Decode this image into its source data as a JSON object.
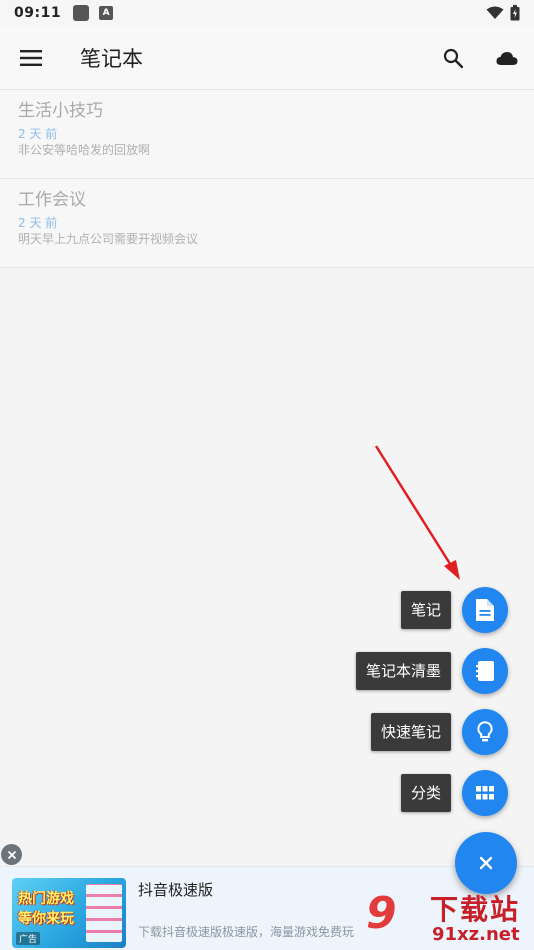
{
  "status_bar": {
    "time": "09:11",
    "a_badge": "A"
  },
  "app_bar": {
    "title": "笔记本",
    "menu_icon": "menu-icon",
    "search_icon": "search-icon",
    "cloud_icon": "cloud-icon"
  },
  "notes": [
    {
      "title": "生活小技巧",
      "date": "2 天 前",
      "preview": "非公安等哈哈发的回放啊"
    },
    {
      "title": "工作会议",
      "date": "2 天 前",
      "preview": "明天早上九点公司需要开视频会议"
    }
  ],
  "fab_menu": {
    "items": [
      {
        "label": "笔记",
        "icon": "note-icon"
      },
      {
        "label": "笔记本清墨",
        "icon": "notebook-icon"
      },
      {
        "label": "快速笔记",
        "icon": "lightbulb-icon"
      },
      {
        "label": "分类",
        "icon": "grid-icon"
      }
    ],
    "main_icon": "close-icon"
  },
  "ad": {
    "title": "抖音极速版",
    "description": "下载抖音极速版极速版，海量游戏免费玩",
    "thumb_line1": "热门游戏",
    "thumb_line2": "等你来玩",
    "thumb_tag": "广告"
  },
  "watermark": {
    "logo": "9",
    "site": "下载站",
    "url": "91xz.net"
  },
  "colors": {
    "accent": "#2186f0",
    "date_text": "#8fbde8",
    "arrow": "#e02020"
  }
}
